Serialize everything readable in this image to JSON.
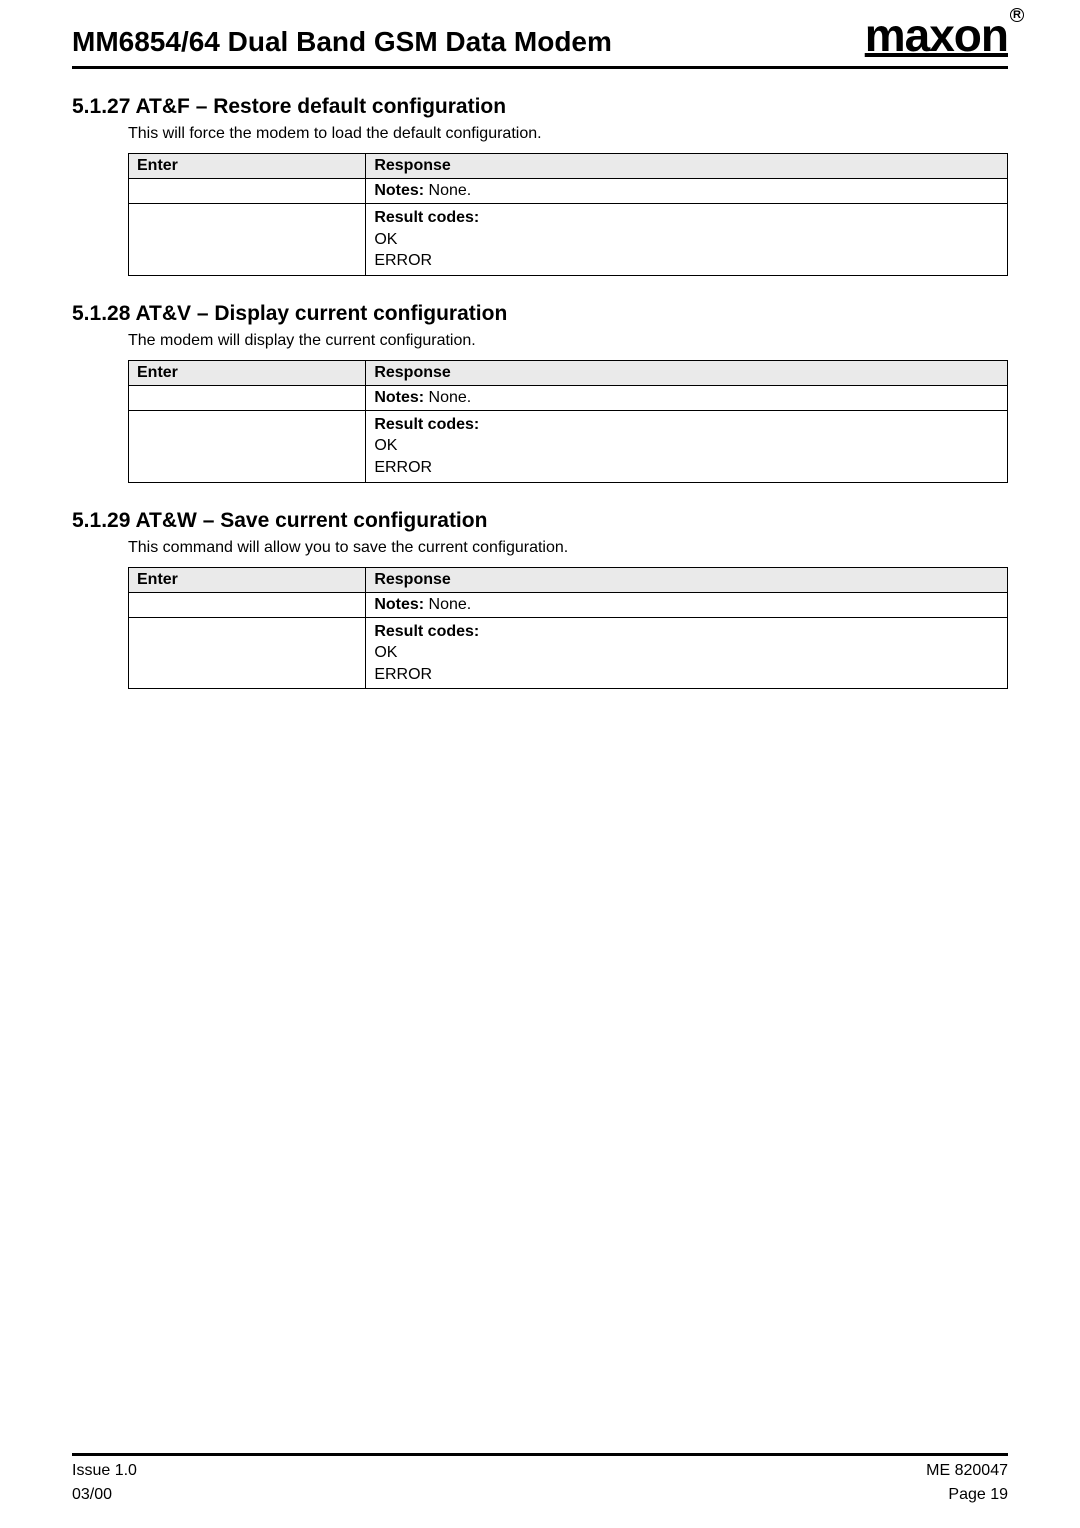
{
  "header": {
    "doc_title": "MM6854/64 Dual Band GSM Data Modem",
    "logo_text": "maxon",
    "reg_mark": "R"
  },
  "table_headers": {
    "enter": "Enter",
    "response": "Response"
  },
  "strings": {
    "notes_label": "Notes:",
    "notes_value": " None.",
    "result_codes_label": "Result codes:",
    "ok": "OK",
    "error": "ERROR"
  },
  "sections": [
    {
      "heading": "5.1.27 AT&F – Restore default configuration",
      "description": "This will force the modem to load the default configuration."
    },
    {
      "heading": "5.1.28 AT&V – Display current configuration",
      "description": "The modem will display the current configuration."
    },
    {
      "heading": "5.1.29 AT&W – Save current configuration",
      "description": "This command will allow you to save the current configuration."
    }
  ],
  "footer": {
    "left_top": "Issue 1.0",
    "left_bottom": "03/00",
    "right_top": "ME 820047",
    "right_bottom": "Page 19"
  }
}
